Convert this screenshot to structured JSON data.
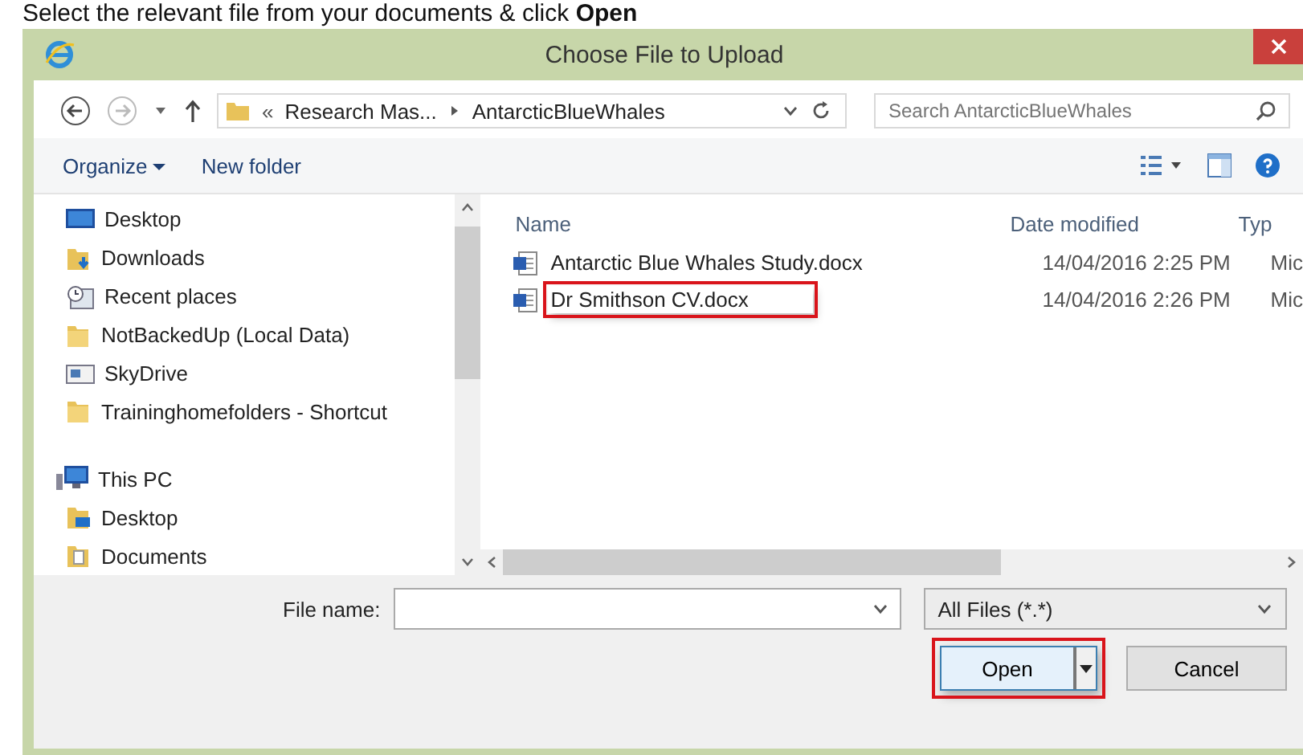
{
  "instruction": "Select the relevant file from your documents & click **Open**",
  "window": {
    "title": "Choose File to Upload"
  },
  "address": {
    "prefix": "«",
    "crumbs": [
      "Research Mas...",
      "AntarcticBlueWhales"
    ],
    "search_placeholder": "Search AntarcticBlueWhales"
  },
  "toolbar": {
    "organize": "Organize",
    "new_folder": "New folder"
  },
  "nav": {
    "items": [
      {
        "label": "Desktop",
        "kind": "monitor"
      },
      {
        "label": "Downloads",
        "kind": "download"
      },
      {
        "label": "Recent places",
        "kind": "recent"
      },
      {
        "label": "NotBackedUp (Local Data)",
        "kind": "folder"
      },
      {
        "label": "SkyDrive",
        "kind": "drive"
      },
      {
        "label": "Traininghomefolders - Shortcut",
        "kind": "folder"
      },
      {
        "label": "This PC",
        "kind": "pc"
      },
      {
        "label": "Desktop",
        "kind": "desktop-folder"
      },
      {
        "label": "Documents",
        "kind": "doc-folder"
      }
    ]
  },
  "columns": [
    "Name",
    "Date modified",
    "Typ"
  ],
  "files": [
    {
      "name": "Antarctic Blue Whales Study.docx",
      "date": "14/04/2016 2:25 PM",
      "type": "Mic",
      "highlighted": false
    },
    {
      "name": "Dr Smithson CV.docx",
      "date": "14/04/2016 2:26 PM",
      "type": "Mic",
      "highlighted": true
    }
  ],
  "bottom": {
    "file_name_label": "File name:",
    "filter": "All Files (*.*)",
    "open": "Open",
    "open_highlighted": true,
    "cancel": "Cancel"
  }
}
